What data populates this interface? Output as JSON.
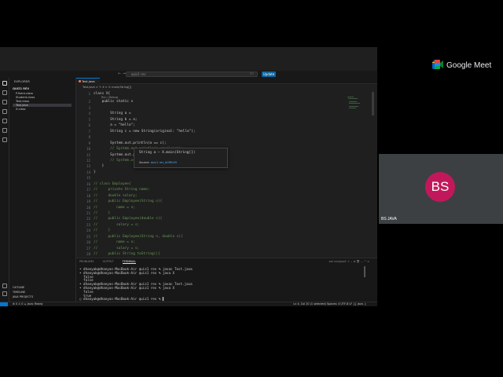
{
  "window": {
    "search_text": "quiz1 rev",
    "update_label": "Update"
  },
  "sidebar": {
    "title": "EXPLORER",
    "folder": "QUIZ1 REV",
    "files": [
      {
        "name": "P.Ihere.class"
      },
      {
        "name": "Student.class"
      },
      {
        "name": "Test.class"
      },
      {
        "name": "Test.java"
      },
      {
        "name": "X.class"
      }
    ],
    "outline": "OUTLINE",
    "timeline": "TIMELINE",
    "java_projects": "JAVA PROJECTS"
  },
  "editor": {
    "tab_label": "Test.java",
    "breadcrumb": "Test.java > ✎ X > ⊙ main(String[])",
    "codelens": "Run | Debug",
    "line_numbers": [
      "1",
      "2",
      "3",
      "4",
      "5",
      "6",
      "7",
      "8",
      "9",
      "10",
      "11",
      "12",
      "13",
      "14",
      "15",
      "16",
      "17",
      "18",
      "19",
      "20",
      "21",
      "22",
      "23",
      "24",
      "25",
      "26",
      "27"
    ],
    "lines": [
      "class X{",
      "    public static v",
      "",
      "        String a = ",
      "        String b = a;",
      "        a = \"hello\";",
      "        String c = new String(original: \"hello\");",
      "",
      "        System.out.println(a == c);",
      "        // System.out.println(a.equals(c));",
      "        System.out.println(a == b);",
      "        // System.out.println(a.equals(b));",
      "    }",
      "}",
      "",
      "// class Employee{",
      "//     private String name;",
      "//     double salary;",
      "//     public Employee(String n){",
      "//         name = n;",
      "//     }",
      "//     public Employee(double s){",
      "//         salary = s;",
      "//     }",
      "//     public Employee(String n, double s){",
      "//         name = n;",
      "//         salary = s;"
    ],
    "extra_line_num": "28",
    "extra_line": "//     public String toString(){"
  },
  "hover": {
    "signature": "String a — X.main(String[])",
    "source_label": "Source:",
    "source_link": "quiz1 rev_b0ff0cf0"
  },
  "panel": {
    "tabs": [
      "PROBLEMS",
      "OUTPUT",
      "TERMINAL"
    ],
    "active_tab": "TERMINAL",
    "right": "zsh  rev/quiz1  +  ⌄  ⧉  🗑  …  ^  ×",
    "terminal_lines": [
      "• dhanyak@dhanyas-MacBook-Air quiz1 rev % javac Test.java",
      "• dhanyak@dhanyas-MacBook-Air quiz1 rev % java X",
      "  false",
      "  false",
      "• dhanyak@dhanyas-MacBook-Air quiz1 rev % javac Test.java",
      "• dhanyak@dhanyas-MacBook-Air quiz1 rev % java X",
      "  false",
      "  true",
      "○ dhanyak@dhanyas-MacBook-Air quiz1 rev % ▌"
    ]
  },
  "statusbar": {
    "left": "⊗ 0 ⚠ 0   ☕ Java: Ready",
    "right": "Ln 4, Col 20 (1 selected)   Spaces: 4   UTF-8   LF   {} Java   ♫"
  },
  "meet": {
    "brand": "Google Meet",
    "participant_initials": "BS",
    "participant_name": "BS JAVA",
    "brand_colors": [
      "#00832d",
      "#0066da",
      "#e94235",
      "#2684fc",
      "#00ac47",
      "#ffba00"
    ],
    "avatar_color": "#c2185b"
  }
}
